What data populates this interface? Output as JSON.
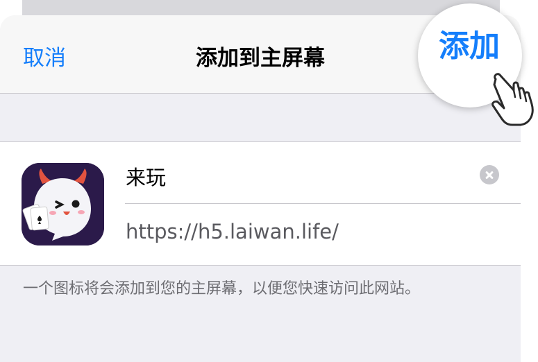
{
  "header": {
    "cancel_label": "取消",
    "title": "添加到主屏幕",
    "add_label": "添加"
  },
  "form": {
    "app_name": "来玩",
    "url": "https://h5.laiwan.life/"
  },
  "footer": {
    "note": "一个图标将会添加到您的主屏幕，以便您快速访问此网站。"
  },
  "colors": {
    "accent": "#147efb",
    "sheet_background": "#efeff4",
    "separator": "#c8c7cc"
  },
  "icons": [
    "app-icon-ghost",
    "clear-text-icon",
    "pointing-hand-icon"
  ]
}
